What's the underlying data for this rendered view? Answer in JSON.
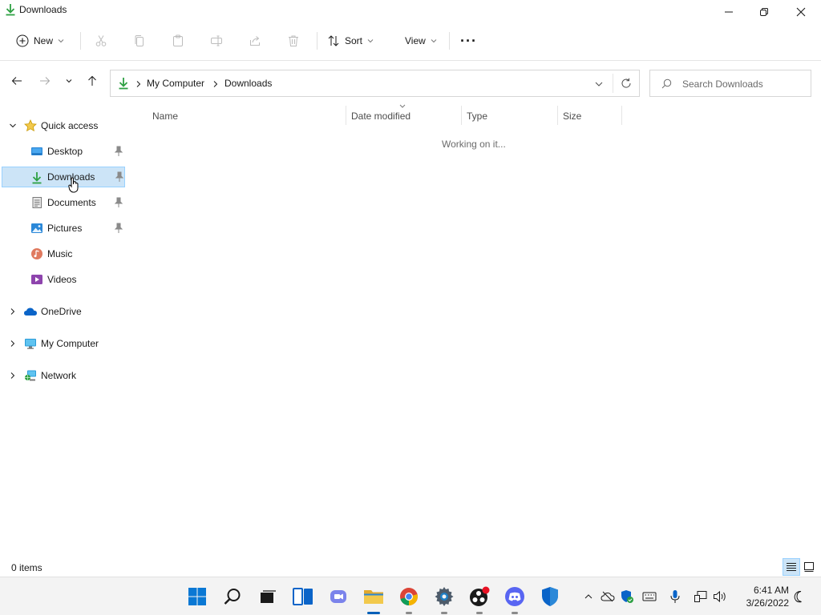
{
  "window": {
    "title": "Downloads"
  },
  "commandbar": {
    "new_label": "New",
    "sort_label": "Sort",
    "view_label": "View",
    "more_label": "···"
  },
  "address": {
    "crumbs": [
      "My Computer",
      "Downloads"
    ],
    "search_placeholder": "Search Downloads"
  },
  "navigation": {
    "quick_access": "Quick access",
    "quick_items": [
      "Desktop",
      "Downloads",
      "Documents",
      "Pictures",
      "Music",
      "Videos"
    ],
    "onedrive": "OneDrive",
    "my_computer": "My Computer",
    "network": "Network"
  },
  "filelist": {
    "columns": [
      "Name",
      "Date modified",
      "Type",
      "Size"
    ],
    "status_message": "Working on it..."
  },
  "statusbar": {
    "item_count": "0 items"
  },
  "taskbar": {
    "time": "6:41 AM",
    "date": "3/26/2022"
  },
  "colors": {
    "accent": "#005fb8",
    "selection": "#cce4f7",
    "selection_border": "#99d1ff",
    "download_green": "#2ea043",
    "folder_yellow": "#f2c94c"
  }
}
